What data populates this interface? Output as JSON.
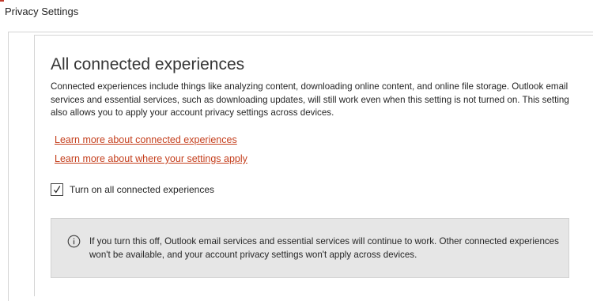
{
  "window": {
    "title": "Privacy Settings"
  },
  "section": {
    "heading": "All connected experiences",
    "description": "Connected experiences include things like analyzing content, downloading online content, and online file storage. Outlook email services and essential services, such as downloading updates, will still work even when this setting is not turned on. This setting also allows you to apply your account privacy settings across devices."
  },
  "links": {
    "learn_more_connected": "Learn more about connected experiences",
    "learn_more_settings": "Learn more about where your settings apply"
  },
  "checkbox": {
    "label": "Turn on all connected experiences",
    "checked": true
  },
  "info": {
    "icon": "info-icon",
    "text": "If you turn this off, Outlook email services and essential services will continue to work. Other connected experiences won't be available, and your account privacy settings won't apply across devices."
  },
  "colors": {
    "link": "#c43e1c",
    "info_background": "#e6e6e6"
  }
}
